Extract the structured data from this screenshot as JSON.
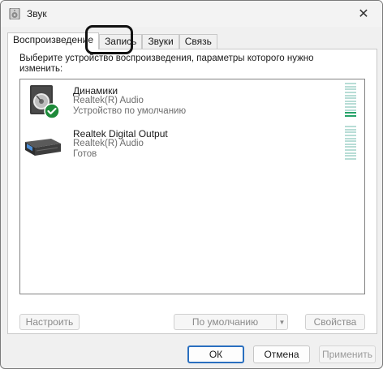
{
  "window": {
    "title": "Звук",
    "close_glyph": "✕"
  },
  "tabs": [
    {
      "label": "Воспроизведение",
      "active": true
    },
    {
      "label": "Запись",
      "active": false
    },
    {
      "label": "Звуки",
      "active": false
    },
    {
      "label": "Связь",
      "active": false
    }
  ],
  "panel": {
    "instruction": "Выберите устройство воспроизведения, параметры которого нужно изменить:"
  },
  "devices": [
    {
      "name": "Динамики",
      "driver": "Realtek(R) Audio",
      "status": "Устройство по умолчанию",
      "icon": "speaker-icon",
      "default": true,
      "level_bars_on": 2
    },
    {
      "name": "Realtek Digital Output",
      "driver": "Realtek(R) Audio",
      "status": "Готов",
      "icon": "digital-output-icon",
      "default": false,
      "level_bars_on": 0
    }
  ],
  "panel_buttons": {
    "configure": "Настроить",
    "set_default": "По умолчанию",
    "properties": "Свойства"
  },
  "dialog_buttons": {
    "ok": "ОК",
    "cancel": "Отмена",
    "apply": "Применить"
  },
  "colors": {
    "accent": "#2a6fbf",
    "meter_on": "#26a269",
    "meter_off": "#b8ddd6",
    "default_check": "#1e8a3a"
  }
}
